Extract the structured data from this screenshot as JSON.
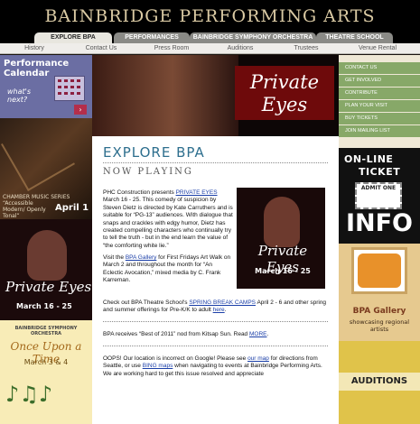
{
  "site": {
    "title": "BAINBRIDGE PERFORMING ARTS"
  },
  "tabs": [
    {
      "label": "EXPLORE BPA",
      "active": true
    },
    {
      "label": "PERFORMANCES"
    },
    {
      "label": "BAINBRIDGE SYMPHONY ORCHESTRA"
    },
    {
      "label": "THEATRE SCHOOL"
    }
  ],
  "subnav": [
    "History",
    "Contact Us",
    "Press Room",
    "Auditions",
    "Trustees",
    "Venue Rental"
  ],
  "left_promos": {
    "calendar": {
      "title_line1": "Performance",
      "title_line2": "Calendar",
      "sub_line1": "what's",
      "sub_line2": "next?",
      "arrow": "›"
    },
    "chamber": {
      "series": "CHAMBER MUSIC SERIES",
      "subtitle": "“Accessible Modern/ Openly Tonal”",
      "date": "April 1"
    },
    "private_eyes": {
      "title": "Private Eyes",
      "dates": "March 16 - 25"
    },
    "bso": {
      "org": "BAINBRIDGE SYMPHONY ORCHESTRA",
      "title": "Once Upon a Time",
      "date": "March 3 & 4",
      "notes": "♪♫♪"
    }
  },
  "banner": {
    "title_line1": "Private",
    "title_line2": "Eyes"
  },
  "content": {
    "heading": "EXPLORE BPA",
    "section": "NOW PLAYING",
    "p1": {
      "a": "PHC Construction presents ",
      "link": "PRIVATE EYES",
      "b": " March 16 - 25. This comedy of suspicion by Steven Dietz is directed by Kate Carruthers and is suitable for “PG-13” audiences. With dialogue that snaps and crackles with edgy humor, Dietz has created compelling characters who continually try to tell the truth - but in the end learn the value of “the comforting white lie.”"
    },
    "p2": {
      "a": "Visit the ",
      "link": "BPA Gallery",
      "b": " for First Fridays Art Walk on March 2 and throughout the month for “An Eclectic Avocation,” mixed media by C. Frank Karreman."
    },
    "p3": {
      "a": "Check out BPA Theatre School's ",
      "link1": "SPRING BREAK CAMPS",
      "b": " April 2 - 6 and other spring and summer offerings for Pre-K/K to adult ",
      "link2": "here",
      "c": "."
    },
    "p4": {
      "a": "BPA receives “Best of 2011” nod from Kitsap Sun. Read ",
      "link": "MORE",
      "b": "."
    },
    "p5": {
      "a": "OOPS! Our location is incorrect on Google! Please see ",
      "link1": "our map",
      "b": " for directions from Seattle, or use ",
      "link2": "BING maps",
      "c": " when navigating to events at Bainbridge Performing Arts. We are working hard to get this issue resolved and appreciate"
    },
    "thumb": {
      "title": "Private Eyes",
      "dates": "March 16 - 25"
    }
  },
  "right_nav": [
    "CONTACT US",
    "GET INVOLVED",
    "CONTRIBUTE",
    "PLAN YOUR VISIT",
    "BUY TICKETS",
    "JOIN MAILING LIST"
  ],
  "right_promos": {
    "ticket": {
      "line1": "ON-LINE",
      "line2": "TICKET",
      "stub": "ADMIT ONE",
      "info": "INFO"
    },
    "gallery": {
      "title": "BPA Gallery",
      "sub": "showcasing regional artists"
    },
    "auditions": {
      "label": "AUDITIONS"
    }
  },
  "colors": {
    "nav_green": "#87a868",
    "heading_blue": "#2e6f8e",
    "link_blue": "#1b3fa8",
    "banner_red": "#6e0a0b"
  }
}
